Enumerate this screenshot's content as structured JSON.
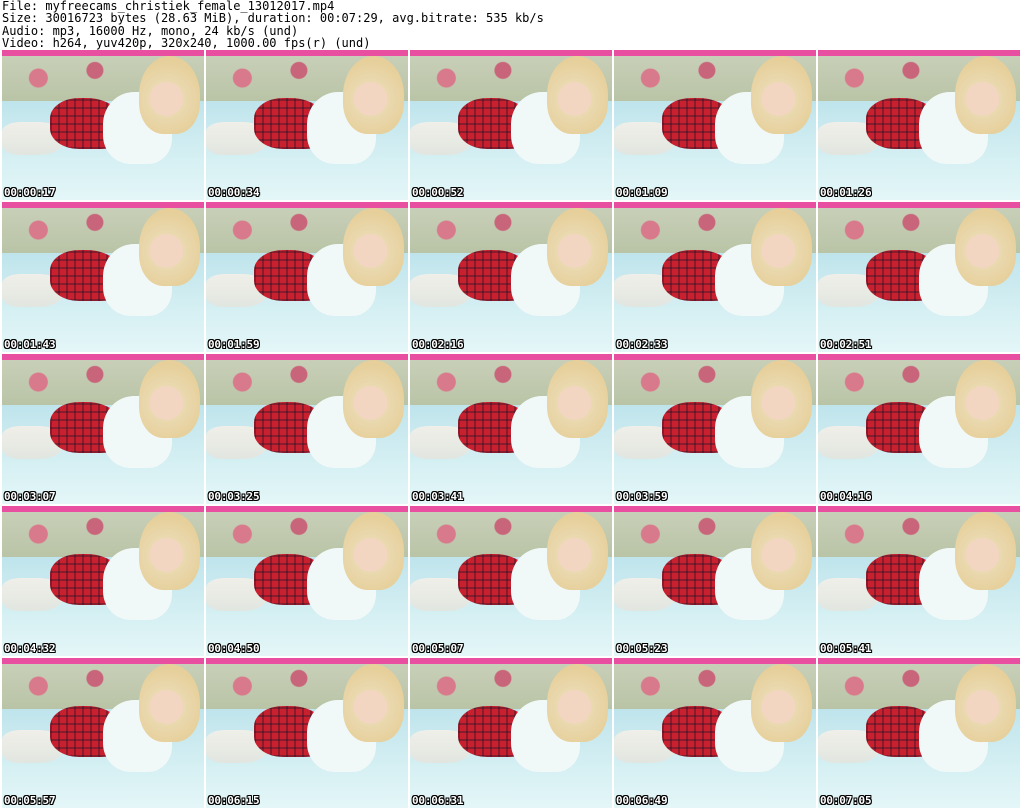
{
  "header": {
    "file": "File: myfreecams_christiek_female_13012017.mp4",
    "size": "Size: 30016723 bytes (28.63 MiB), duration: 00:07:29, avg.bitrate: 535 kb/s",
    "audio": "Audio: mp3, 16000 Hz, mono, 24 kb/s (und)",
    "video": "Video: h264, yuv420p, 320x240, 1000.00 fps(r) (und)"
  },
  "thumbnails": [
    {
      "timestamp": "00:00:17"
    },
    {
      "timestamp": "00:00:34"
    },
    {
      "timestamp": "00:00:52"
    },
    {
      "timestamp": "00:01:09"
    },
    {
      "timestamp": "00:01:26"
    },
    {
      "timestamp": "00:01:43"
    },
    {
      "timestamp": "00:01:59"
    },
    {
      "timestamp": "00:02:16"
    },
    {
      "timestamp": "00:02:33"
    },
    {
      "timestamp": "00:02:51"
    },
    {
      "timestamp": "00:03:07"
    },
    {
      "timestamp": "00:03:25"
    },
    {
      "timestamp": "00:03:41"
    },
    {
      "timestamp": "00:03:59"
    },
    {
      "timestamp": "00:04:16"
    },
    {
      "timestamp": "00:04:32"
    },
    {
      "timestamp": "00:04:50"
    },
    {
      "timestamp": "00:05:07"
    },
    {
      "timestamp": "00:05:23"
    },
    {
      "timestamp": "00:05:41"
    },
    {
      "timestamp": "00:05:57"
    },
    {
      "timestamp": "00:06:15"
    },
    {
      "timestamp": "00:06:31"
    },
    {
      "timestamp": "00:06:49"
    },
    {
      "timestamp": "00:07:05"
    }
  ]
}
